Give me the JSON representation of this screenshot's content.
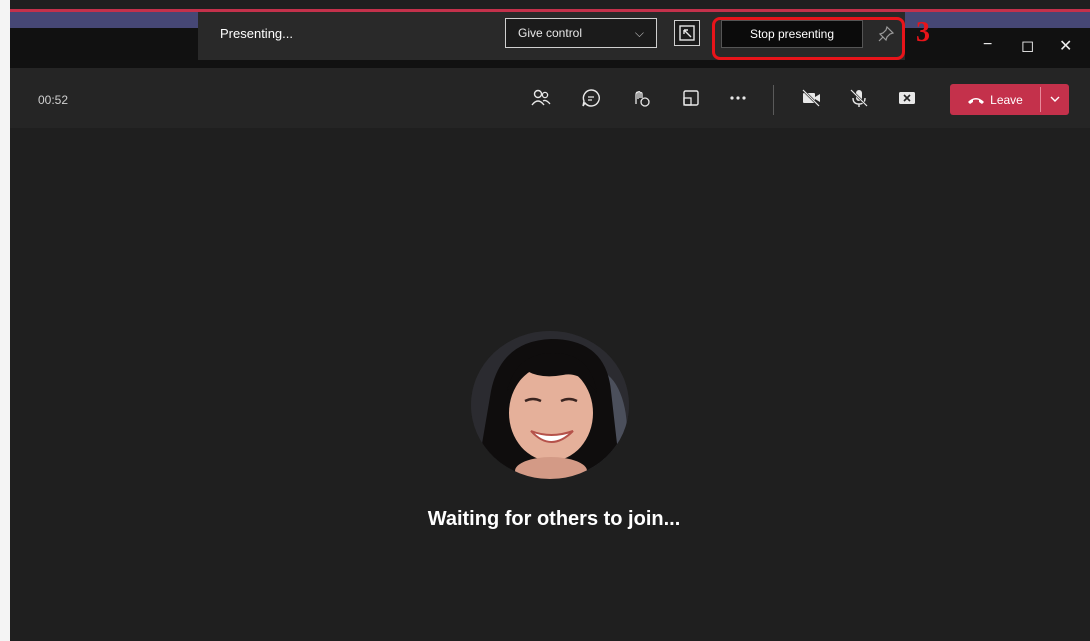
{
  "presenting_bar": {
    "status_text": "Presenting...",
    "give_control": {
      "label": "Give control",
      "icon": "chevron-down-icon"
    },
    "popout_icon": "present-popout-icon",
    "stop_button_label": "Stop presenting",
    "pin_icon": "pin-icon"
  },
  "annotation": {
    "number": "3",
    "color": "#e8141a"
  },
  "window_controls": {
    "minimize": "−",
    "maximize": "◻",
    "close": "✕"
  },
  "meeting": {
    "timer": "00:52",
    "icons": [
      "people-icon",
      "chat-icon",
      "reactions-icon",
      "rooms-icon",
      "more-icon",
      "camera-off-icon",
      "mic-off-icon",
      "share-tray-icon"
    ],
    "leave_button": {
      "label": "Leave",
      "color": "#c4314b",
      "icon": "phone-hangup-icon"
    }
  },
  "stage": {
    "status_message": "Waiting for others to join..."
  },
  "colors": {
    "background": "#1f1f1f",
    "accent": "#464775"
  }
}
